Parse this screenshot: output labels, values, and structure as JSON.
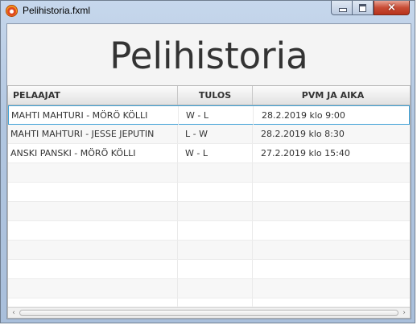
{
  "window": {
    "title": "Pelihistoria.fxml",
    "icon": "app-icon",
    "buttons": {
      "minimize": "minimize-icon",
      "maximize": "maximize-icon",
      "close": "×"
    }
  },
  "main": {
    "heading": "Pelihistoria"
  },
  "table": {
    "columns": [
      "PELAAJAT",
      "TULOS",
      "PVM  JA AIKA"
    ],
    "rows": [
      [
        "MAHTI MAHTURI - MÖRÖ KÖLLI",
        "W - L",
        "28.2.2019 klo 9:00"
      ],
      [
        "MAHTI MAHTURI - JESSE JEPUTIN",
        "L  - W",
        "28.2.2019 klo 8:30"
      ],
      [
        "ANSKI PANSKI - MÖRÖ KÖLLI",
        "W - L",
        "27.2.2019 klo 15:40"
      ]
    ],
    "selected_row": 0
  },
  "scrollbar": {
    "left_arrow": "‹",
    "right_arrow": "›"
  },
  "colors": {
    "selection_border": "#3ea0d6",
    "title_bar": "#b1c6e0",
    "close_button": "#c74c35"
  }
}
